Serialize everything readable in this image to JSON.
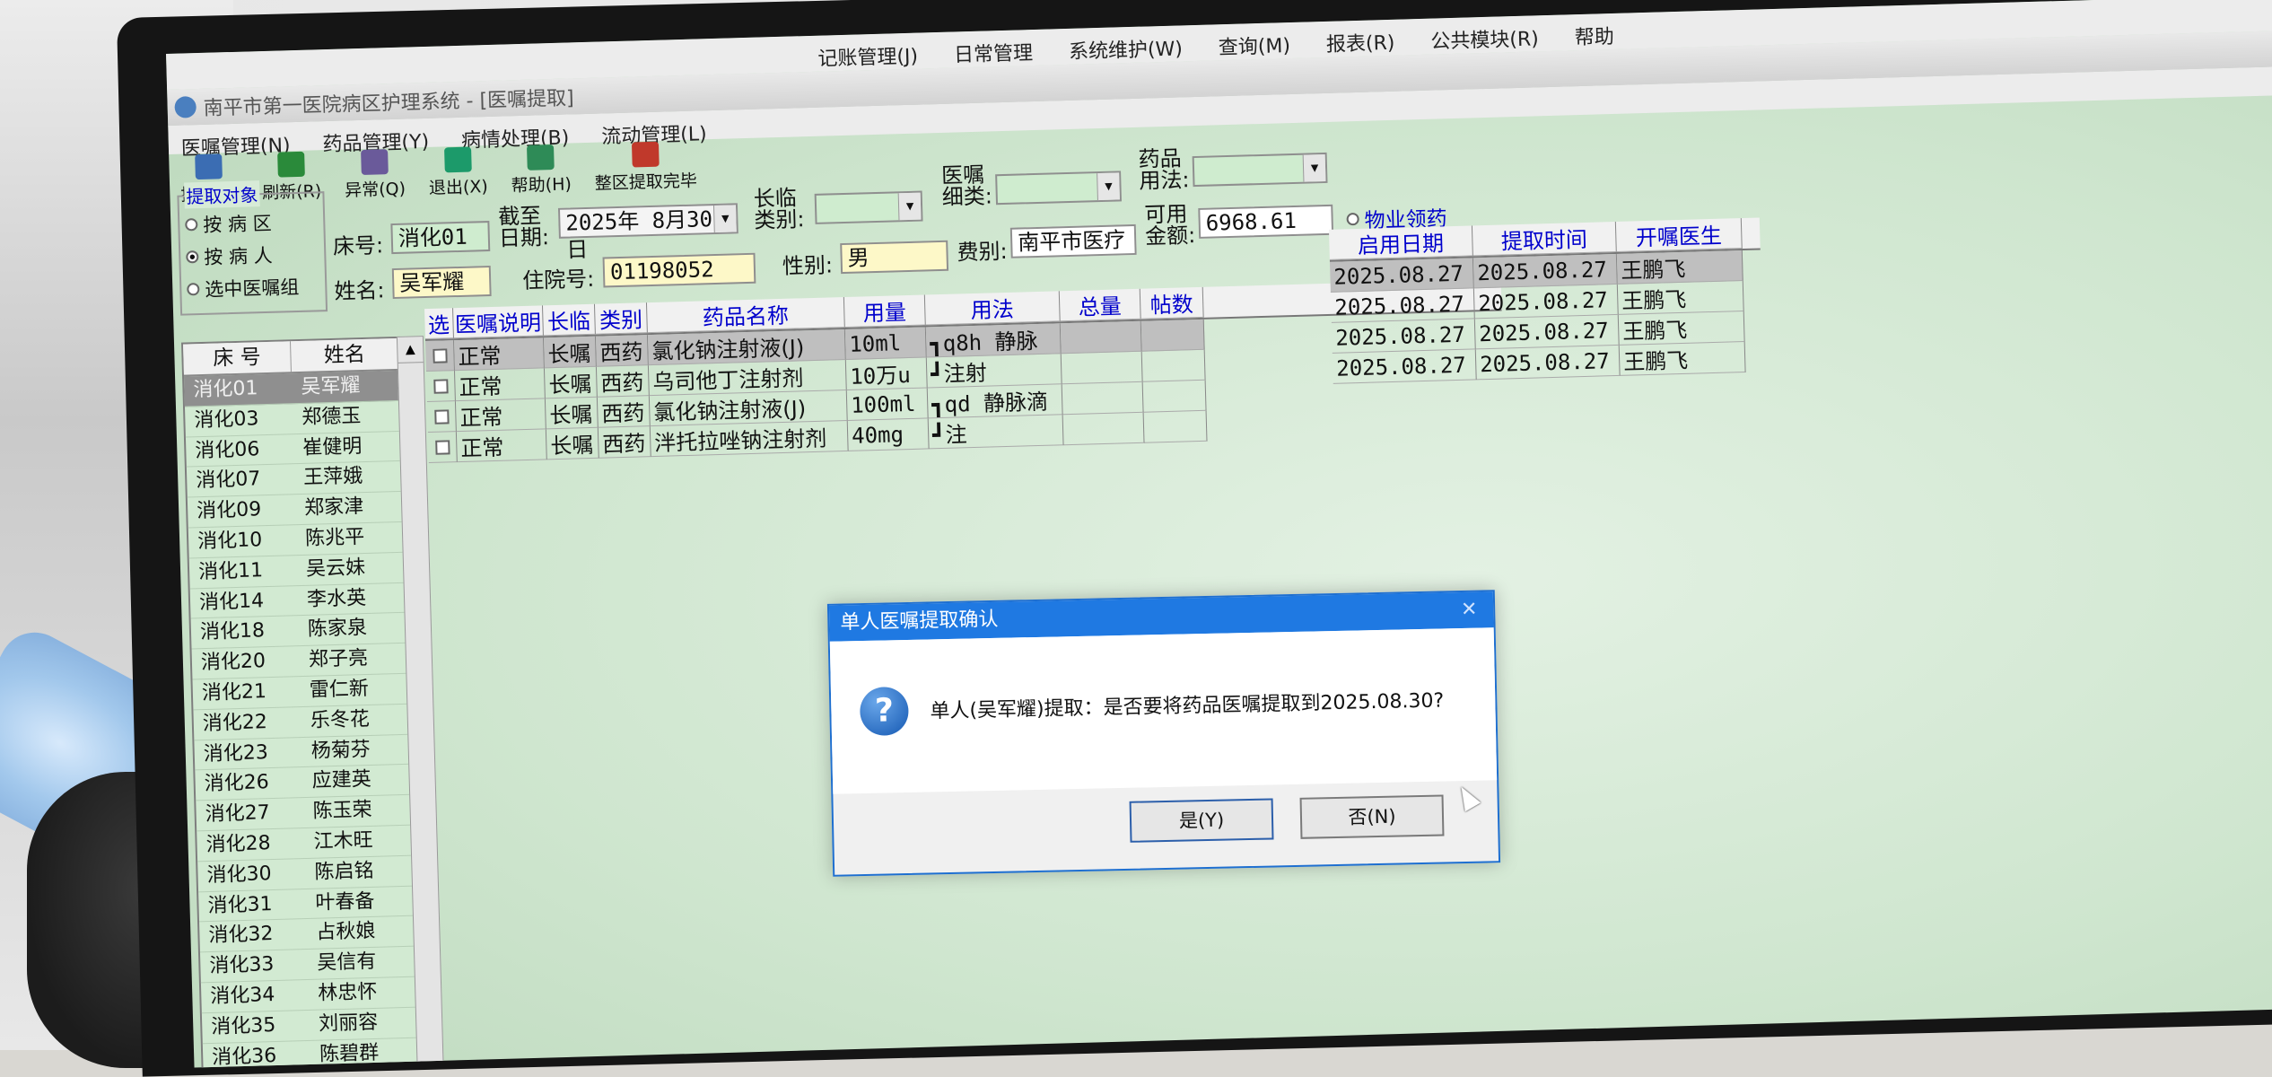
{
  "window": {
    "title": "南平市第一医院病区护理系统 - [医嘱提取]"
  },
  "menu_top": [
    "记账管理(J)",
    "日常管理",
    "系统维护(W)",
    "查询(M)",
    "报表(R)",
    "公共模块(R)",
    "帮助"
  ],
  "menu_main": [
    "医嘱管理(N)",
    "药品管理(Y)",
    "病情处理(B)",
    "流动管理(L)"
  ],
  "toolbar": [
    {
      "label": "提取(E)",
      "icon": "extract-icon"
    },
    {
      "label": "刷新(R)",
      "icon": "refresh-icon"
    },
    {
      "label": "异常(Q)",
      "icon": "exception-icon"
    },
    {
      "label": "退出(X)",
      "icon": "exit-icon"
    },
    {
      "label": "帮助(H)",
      "icon": "help-icon"
    },
    {
      "label": "整区提取完毕",
      "icon": "ward-extract-icon"
    }
  ],
  "extract_target": {
    "title": "提取对象",
    "options": [
      "按 病 区",
      "按 病 人",
      "选中医嘱组"
    ],
    "selected_index": 1
  },
  "form": {
    "bed_label": "床号:",
    "bed_value": "消化01",
    "name_label": "姓名:",
    "name_value": "吴军耀",
    "date_label": "截至日期:",
    "date_value": "2025年 8月30日",
    "admission_label": "住院号:",
    "admission_value": "01198052",
    "longtemp_label": "长临类别:",
    "longtemp_value": "",
    "gender_label": "性别:",
    "gender_value": "男",
    "order_sub_label": "医嘱细类:",
    "order_sub_value": "",
    "fee_label": "费别:",
    "fee_value": "南平市医疗",
    "usage_label": "药品用法:",
    "usage_value": "",
    "amount_label": "可用金额:",
    "amount_value": "6968.61",
    "property_option": "物业领药"
  },
  "patients": {
    "headers": [
      "床 号",
      "姓名"
    ],
    "rows": [
      [
        "消化01",
        "吴军耀"
      ],
      [
        "消化03",
        "郑德玉"
      ],
      [
        "消化06",
        "崔健明"
      ],
      [
        "消化07",
        "王萍娥"
      ],
      [
        "消化09",
        "郑家津"
      ],
      [
        "消化10",
        "陈兆平"
      ],
      [
        "消化11",
        "吴云妹"
      ],
      [
        "消化14",
        "李水英"
      ],
      [
        "消化18",
        "陈家泉"
      ],
      [
        "消化20",
        "郑子亮"
      ],
      [
        "消化21",
        "雷仁新"
      ],
      [
        "消化22",
        "乐冬花"
      ],
      [
        "消化23",
        "杨菊芬"
      ],
      [
        "消化26",
        "应建英"
      ],
      [
        "消化27",
        "陈玉荣"
      ],
      [
        "消化28",
        "江木旺"
      ],
      [
        "消化30",
        "陈启铭"
      ],
      [
        "消化31",
        "叶春备"
      ],
      [
        "消化32",
        "占秋娘"
      ],
      [
        "消化33",
        "吴信有"
      ],
      [
        "消化34",
        "林忠怀"
      ],
      [
        "消化35",
        "刘丽容"
      ],
      [
        "消化36",
        "陈碧群"
      ]
    ],
    "selected_index": 0
  },
  "orders": {
    "headers": [
      "选",
      "医嘱说明",
      "长临",
      "类别",
      "药品名称",
      "用量",
      "用法",
      "总量",
      "帖数"
    ],
    "rows": [
      [
        "",
        "正常",
        "长嘱",
        "西药",
        "氯化钠注射液(J)",
        "10ml",
        "┓q8h 静脉",
        "",
        ""
      ],
      [
        "",
        "正常",
        "长嘱",
        "西药",
        "乌司他丁注射剂",
        "10万u",
        "┛注射",
        "",
        ""
      ],
      [
        "",
        "正常",
        "长嘱",
        "西药",
        "氯化钠注射液(J)",
        "100ml",
        "┓qd 静脉滴",
        "",
        ""
      ],
      [
        "",
        "正常",
        "长嘱",
        "西药",
        "泮托拉唑钠注射剂",
        "40mg",
        "┛注",
        "",
        ""
      ]
    ]
  },
  "orders_right": {
    "headers": [
      "启用日期",
      "提取时间",
      "开嘱医生"
    ],
    "rows": [
      [
        "2025.08.27",
        "2025.08.27",
        "王鹏飞"
      ],
      [
        "2025.08.27",
        "2025.08.27",
        "王鹏飞"
      ],
      [
        "2025.08.27",
        "2025.08.27",
        "王鹏飞"
      ],
      [
        "2025.08.27",
        "2025.08.27",
        "王鹏飞"
      ]
    ]
  },
  "dialog": {
    "title": "单人医嘱提取确认",
    "message": "单人(吴军耀)提取：是否要将药品医嘱提取到2025.08.30?",
    "yes": "是(Y)",
    "no": "否(N)",
    "close": "✕"
  }
}
